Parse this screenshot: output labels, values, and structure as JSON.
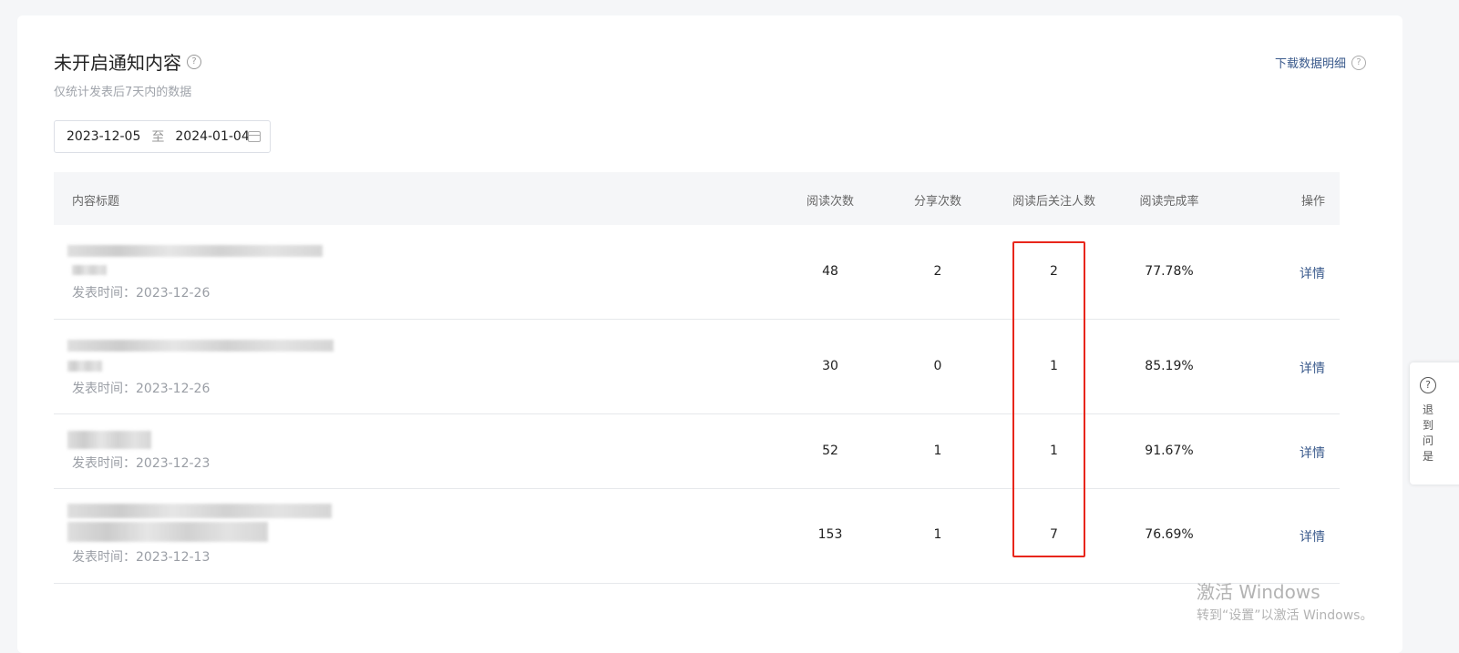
{
  "header": {
    "title": "未开启通知内容",
    "subtitle": "仅统计发表后7天内的数据",
    "download_label": "下载数据明细",
    "help_glyph": "?"
  },
  "date_range": {
    "start": "2023-12-05",
    "separator": "至",
    "end": "2024-01-04"
  },
  "table": {
    "columns": {
      "title": "内容标题",
      "reads": "阅读次数",
      "shares": "分享次数",
      "follows": "阅读后关注人数",
      "completion": "阅读完成率",
      "action": "操作"
    },
    "rows": [
      {
        "publish_time": "发表时间：2023-12-26",
        "reads": "48",
        "shares": "2",
        "follows": "2",
        "completion": "77.78%",
        "action": "详情"
      },
      {
        "publish_time": "发表时间：2023-12-26",
        "reads": "30",
        "shares": "0",
        "follows": "1",
        "completion": "85.19%",
        "action": "详情"
      },
      {
        "publish_time": "发表时间：2023-12-23",
        "reads": "52",
        "shares": "1",
        "follows": "1",
        "completion": "91.67%",
        "action": "详情"
      },
      {
        "publish_time": "发表时间：2023-12-13",
        "reads": "153",
        "shares": "1",
        "follows": "7",
        "completion": "76.69%",
        "action": "详情"
      }
    ]
  },
  "side_widget": {
    "icon": "?",
    "lines": [
      "退",
      "到",
      "问",
      "是"
    ]
  },
  "watermark": {
    "line1": "激活 Windows",
    "line2": "转到“设置”以激活 Windows。"
  },
  "colors": {
    "highlight": "#e8261b",
    "link": "#3a5a8c"
  }
}
